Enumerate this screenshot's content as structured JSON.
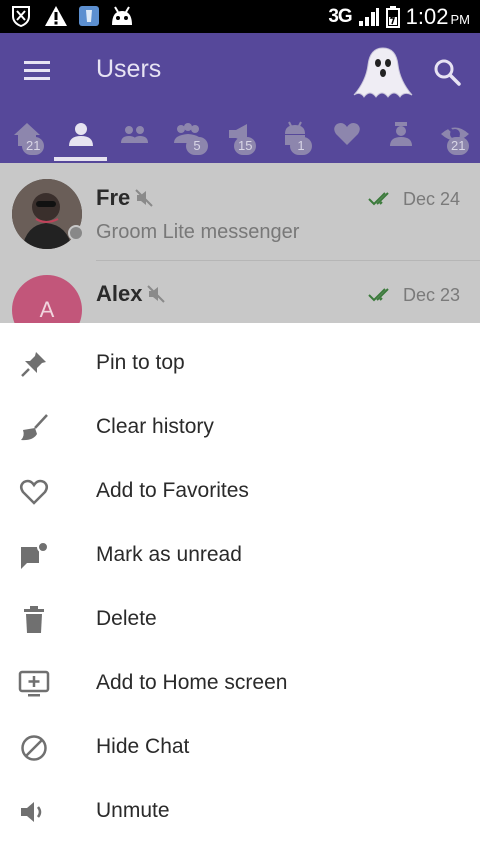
{
  "status_bar": {
    "network": "3G",
    "time": "1:02",
    "ampm": "PM"
  },
  "toolbar": {
    "title": "Users"
  },
  "tabs": [
    {
      "icon": "home-icon",
      "badge": "21"
    },
    {
      "icon": "person-icon",
      "badge": ""
    },
    {
      "icon": "group-icon",
      "badge": ""
    },
    {
      "icon": "groups-icon",
      "badge": "5"
    },
    {
      "icon": "channel-icon",
      "badge": "15"
    },
    {
      "icon": "bot-icon",
      "badge": "1"
    },
    {
      "icon": "heart-icon",
      "badge": ""
    },
    {
      "icon": "admin-icon",
      "badge": ""
    },
    {
      "icon": "hidden-icon",
      "badge": "21"
    }
  ],
  "chats": [
    {
      "name": "Fre",
      "date": "Dec 24",
      "preview": "Groom Lite messenger"
    },
    {
      "name": "Alex",
      "date": "Dec 23",
      "avatar_letter": "A"
    }
  ],
  "sheet": [
    {
      "icon": "pin-icon",
      "label": "Pin to top"
    },
    {
      "icon": "broom-icon",
      "label": "Clear history"
    },
    {
      "icon": "heart-outline-icon",
      "label": "Add to Favorites"
    },
    {
      "icon": "unread-icon",
      "label": "Mark as unread"
    },
    {
      "icon": "trash-icon",
      "label": "Delete"
    },
    {
      "icon": "add-home-icon",
      "label": "Add to Home screen"
    },
    {
      "icon": "block-icon",
      "label": "Hide Chat"
    },
    {
      "icon": "volume-icon",
      "label": "Unmute"
    }
  ],
  "colors": {
    "primary": "#56489a",
    "badge": "#8d86ad",
    "check": "#3b7a3b"
  }
}
